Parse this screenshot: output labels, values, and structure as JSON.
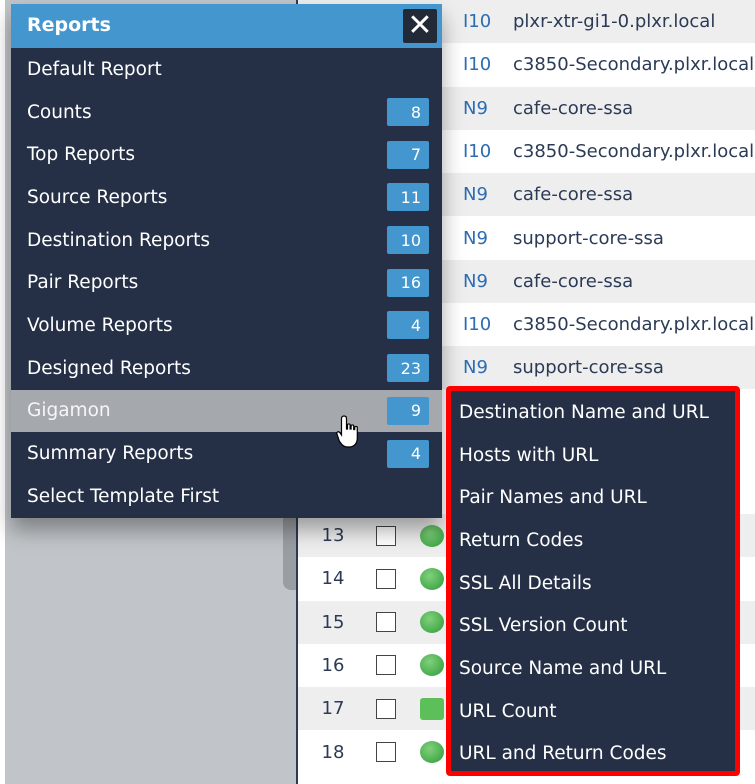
{
  "background": {
    "left_pane_color": "#c1c5c9"
  },
  "table": {
    "top_rows": [
      {
        "type": "I10",
        "host": "plxr-xtr-gi1-0.plxr.local"
      },
      {
        "type": "I10",
        "host": "c3850-Secondary.plxr.local"
      },
      {
        "type": "N9",
        "host": "cafe-core-ssa"
      },
      {
        "type": "I10",
        "host": "c3850-Secondary.plxr.local"
      },
      {
        "type": "N9",
        "host": "cafe-core-ssa"
      },
      {
        "type": "N9",
        "host": "support-core-ssa"
      },
      {
        "type": "N9",
        "host": "cafe-core-ssa"
      },
      {
        "type": "I10",
        "host": "c3850-Secondary.plxr.local"
      },
      {
        "type": "N9",
        "host": "support-core-ssa"
      }
    ],
    "bottom_rows": [
      {
        "num": "13",
        "status_icon": "router-icon"
      },
      {
        "num": "14",
        "status_icon": "router-icon"
      },
      {
        "num": "15",
        "status_icon": "router-icon"
      },
      {
        "num": "16",
        "status_icon": "router-icon"
      },
      {
        "num": "17",
        "status_icon": "monitor-icon"
      },
      {
        "num": "18",
        "status_icon": "router-icon"
      }
    ]
  },
  "menu": {
    "title": "Reports",
    "close_icon": "close-icon",
    "accent_color": "#4496cf",
    "items": [
      {
        "label": "Default Report",
        "count": null
      },
      {
        "label": "Counts",
        "count": "8"
      },
      {
        "label": "Top Reports",
        "count": "7"
      },
      {
        "label": "Source Reports",
        "count": "11"
      },
      {
        "label": "Destination Reports",
        "count": "10"
      },
      {
        "label": "Pair Reports",
        "count": "16"
      },
      {
        "label": "Volume Reports",
        "count": "4"
      },
      {
        "label": "Designed Reports",
        "count": "23"
      },
      {
        "label": "Gigamon",
        "count": "9",
        "active": true
      },
      {
        "label": "Summary Reports",
        "count": "4"
      },
      {
        "label": "Select Template First",
        "count": null
      }
    ]
  },
  "submenu": {
    "parent": "Gigamon",
    "highlight_color": "#ff0000",
    "items": [
      "Destination Name and URL",
      "Hosts with URL",
      "Pair Names and URL",
      "Return Codes",
      "SSL All Details",
      "SSL Version Count",
      "Source Name and URL",
      "URL Count",
      "URL and Return Codes"
    ]
  }
}
